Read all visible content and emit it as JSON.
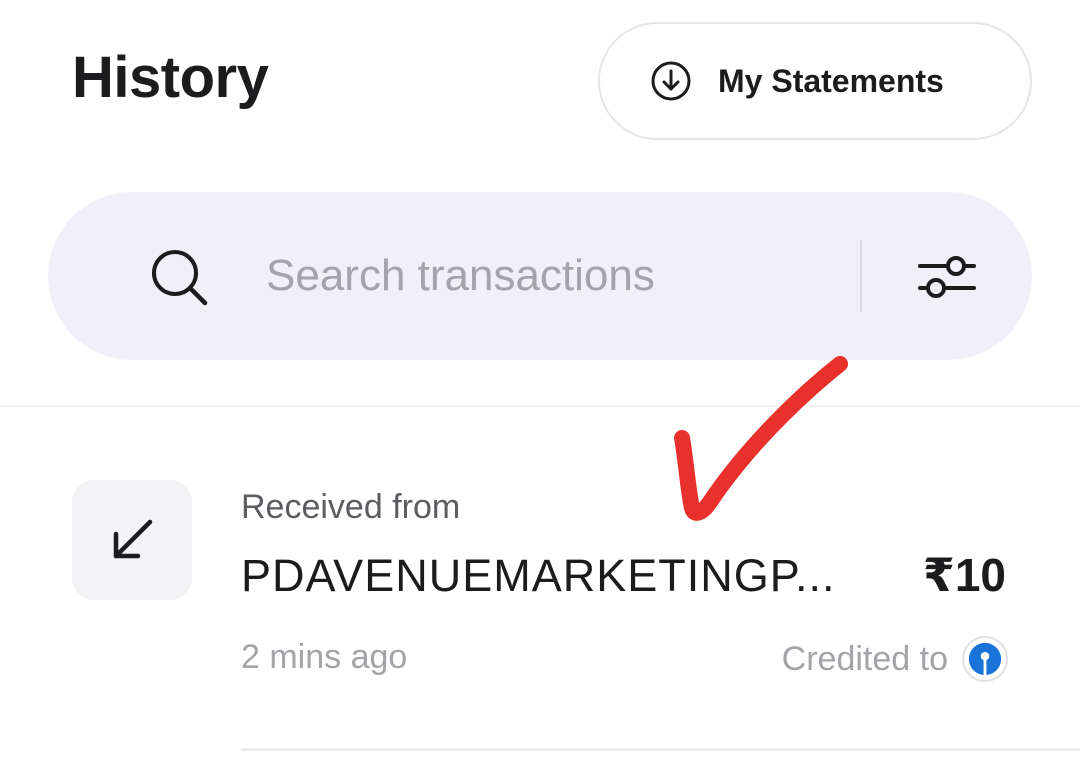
{
  "header": {
    "title": "History",
    "statements_label": "My Statements",
    "statements_icon": "download-circle-icon"
  },
  "search": {
    "placeholder": "Search transactions",
    "value": "",
    "search_icon": "search-icon",
    "filter_icon": "filter-sliders-icon"
  },
  "transactions": [
    {
      "direction_icon": "arrow-down-left-icon",
      "type_label": "Received from",
      "name": "PDAVENUEMARKETINGP...",
      "amount": "₹10",
      "time": "2 mins ago",
      "credited_label": "Credited to",
      "bank_icon": "bank-logo-icon"
    }
  ],
  "annotation": {
    "icon": "checkmark-icon",
    "color": "#e8302c"
  },
  "colors": {
    "search_bg": "#f1eff7",
    "bank_logo_blue": "#1a73d9"
  }
}
